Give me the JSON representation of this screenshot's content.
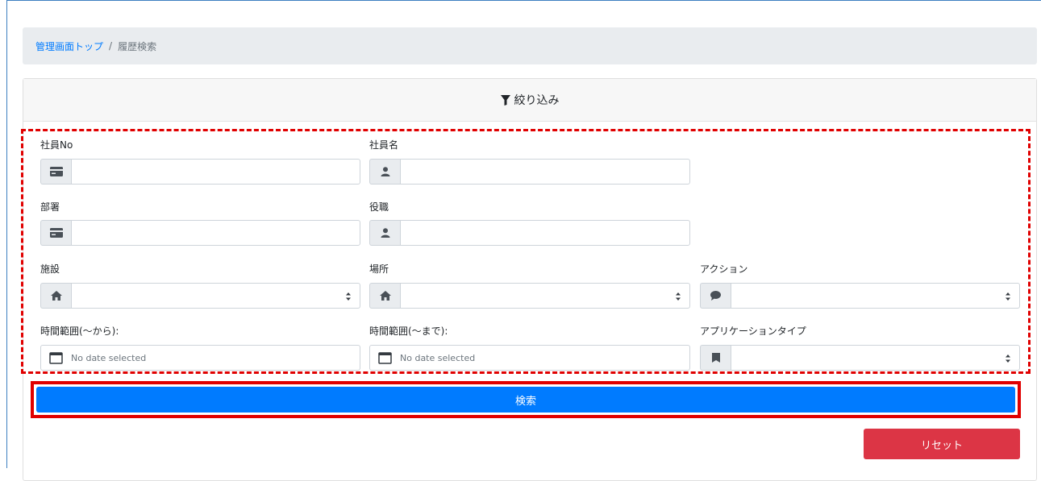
{
  "breadcrumb": {
    "home": "管理画面トップ",
    "separator": "/",
    "current": "履歴検索"
  },
  "filter": {
    "header": "絞り込み",
    "header_icon": "filter-icon"
  },
  "fields": {
    "employee_no": {
      "label": "社員No",
      "icon": "id-card-icon",
      "value": ""
    },
    "employee_name": {
      "label": "社員名",
      "icon": "user-icon",
      "value": ""
    },
    "department": {
      "label": "部署",
      "icon": "id-card-icon",
      "value": ""
    },
    "position": {
      "label": "役職",
      "icon": "user-icon",
      "value": ""
    },
    "facility": {
      "label": "施設",
      "icon": "home-icon",
      "value": ""
    },
    "location": {
      "label": "場所",
      "icon": "home-icon",
      "value": ""
    },
    "action": {
      "label": "アクション",
      "icon": "comment-icon",
      "value": ""
    },
    "time_from": {
      "label": "時間範囲(～から):",
      "icon": "calendar-icon",
      "placeholder": "No date selected"
    },
    "time_to": {
      "label": "時間範囲(～まで):",
      "icon": "calendar-icon",
      "placeholder": "No date selected"
    },
    "app_type": {
      "label": "アプリケーションタイプ",
      "icon": "bookmark-icon",
      "value": ""
    }
  },
  "buttons": {
    "search": "検索",
    "reset": "リセット"
  },
  "colors": {
    "primary": "#007bff",
    "danger": "#dc3545",
    "annotation": "#e00000"
  }
}
